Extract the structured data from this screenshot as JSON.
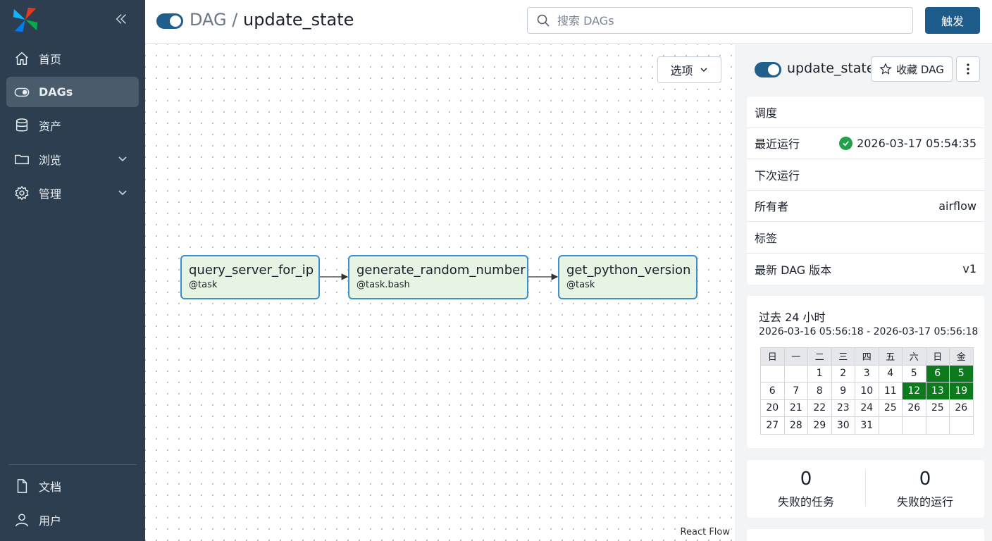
{
  "sidebar": {
    "items": [
      {
        "label": "首页",
        "icon": "home-icon"
      },
      {
        "label": "DAGs",
        "icon": "dag-toggle-icon"
      },
      {
        "label": "资产",
        "icon": "database-icon"
      },
      {
        "label": "浏览",
        "icon": "folder-icon"
      },
      {
        "label": "管理",
        "icon": "gear-icon"
      }
    ],
    "bottom": [
      {
        "label": "文档",
        "icon": "document-icon"
      },
      {
        "label": "用户",
        "icon": "user-icon"
      }
    ]
  },
  "header": {
    "crumb_root": "DAG",
    "crumb_sep": "/",
    "crumb_current": "update_state",
    "search_placeholder": "搜索 DAGs",
    "trigger_label": "触发"
  },
  "graph": {
    "options_label": "选项",
    "tasks": [
      {
        "name": "query_server_for_ip",
        "type": "@task"
      },
      {
        "name": "generate_random_number",
        "type": "@task.bash"
      },
      {
        "name": "get_python_version",
        "type": "@task"
      }
    ],
    "attribution": "React Flow"
  },
  "details": {
    "title": "update_state",
    "favorite_label": "收藏 DAG",
    "rows": [
      {
        "label": "调度",
        "value": ""
      },
      {
        "label": "最近运行",
        "value": "2026-03-17 05:54:35"
      },
      {
        "label": "下次运行",
        "value": ""
      },
      {
        "label": "所有者",
        "value": "airflow"
      },
      {
        "label": "标签",
        "value": ""
      },
      {
        "label": "最新 DAG 版本",
        "value": "v1"
      }
    ],
    "last_run_status": "success"
  },
  "calendar": {
    "title": "过去 24 小时",
    "range": "2026-03-16 05:56:18 - 2026-03-17 05:56:18",
    "weekdays": [
      "日",
      "一",
      "二",
      "三",
      "四",
      "五",
      "六",
      "日",
      "金"
    ],
    "rows": [
      [
        "",
        "",
        "1",
        "2",
        "3",
        "4",
        "5",
        "6",
        "5"
      ],
      [
        "6",
        "7",
        "8",
        "9",
        "10",
        "11",
        "12",
        "13",
        "19"
      ],
      [
        "20",
        "21",
        "22",
        "23",
        "24",
        "25",
        "26",
        "25",
        "26"
      ],
      [
        "27",
        "28",
        "29",
        "30",
        "31",
        "",
        "",
        "",
        ""
      ]
    ],
    "highlight_color": "#0d7a1d"
  },
  "stats": [
    {
      "value": "0",
      "label": "失败的任务"
    },
    {
      "value": "0",
      "label": "失败的运行"
    }
  ],
  "colors": {
    "sidebar": "#2c3e50",
    "accent": "#1d5b8a",
    "task_fill": "#e6f4e3",
    "task_border": "#3d8fcf",
    "success": "#22a04a"
  }
}
